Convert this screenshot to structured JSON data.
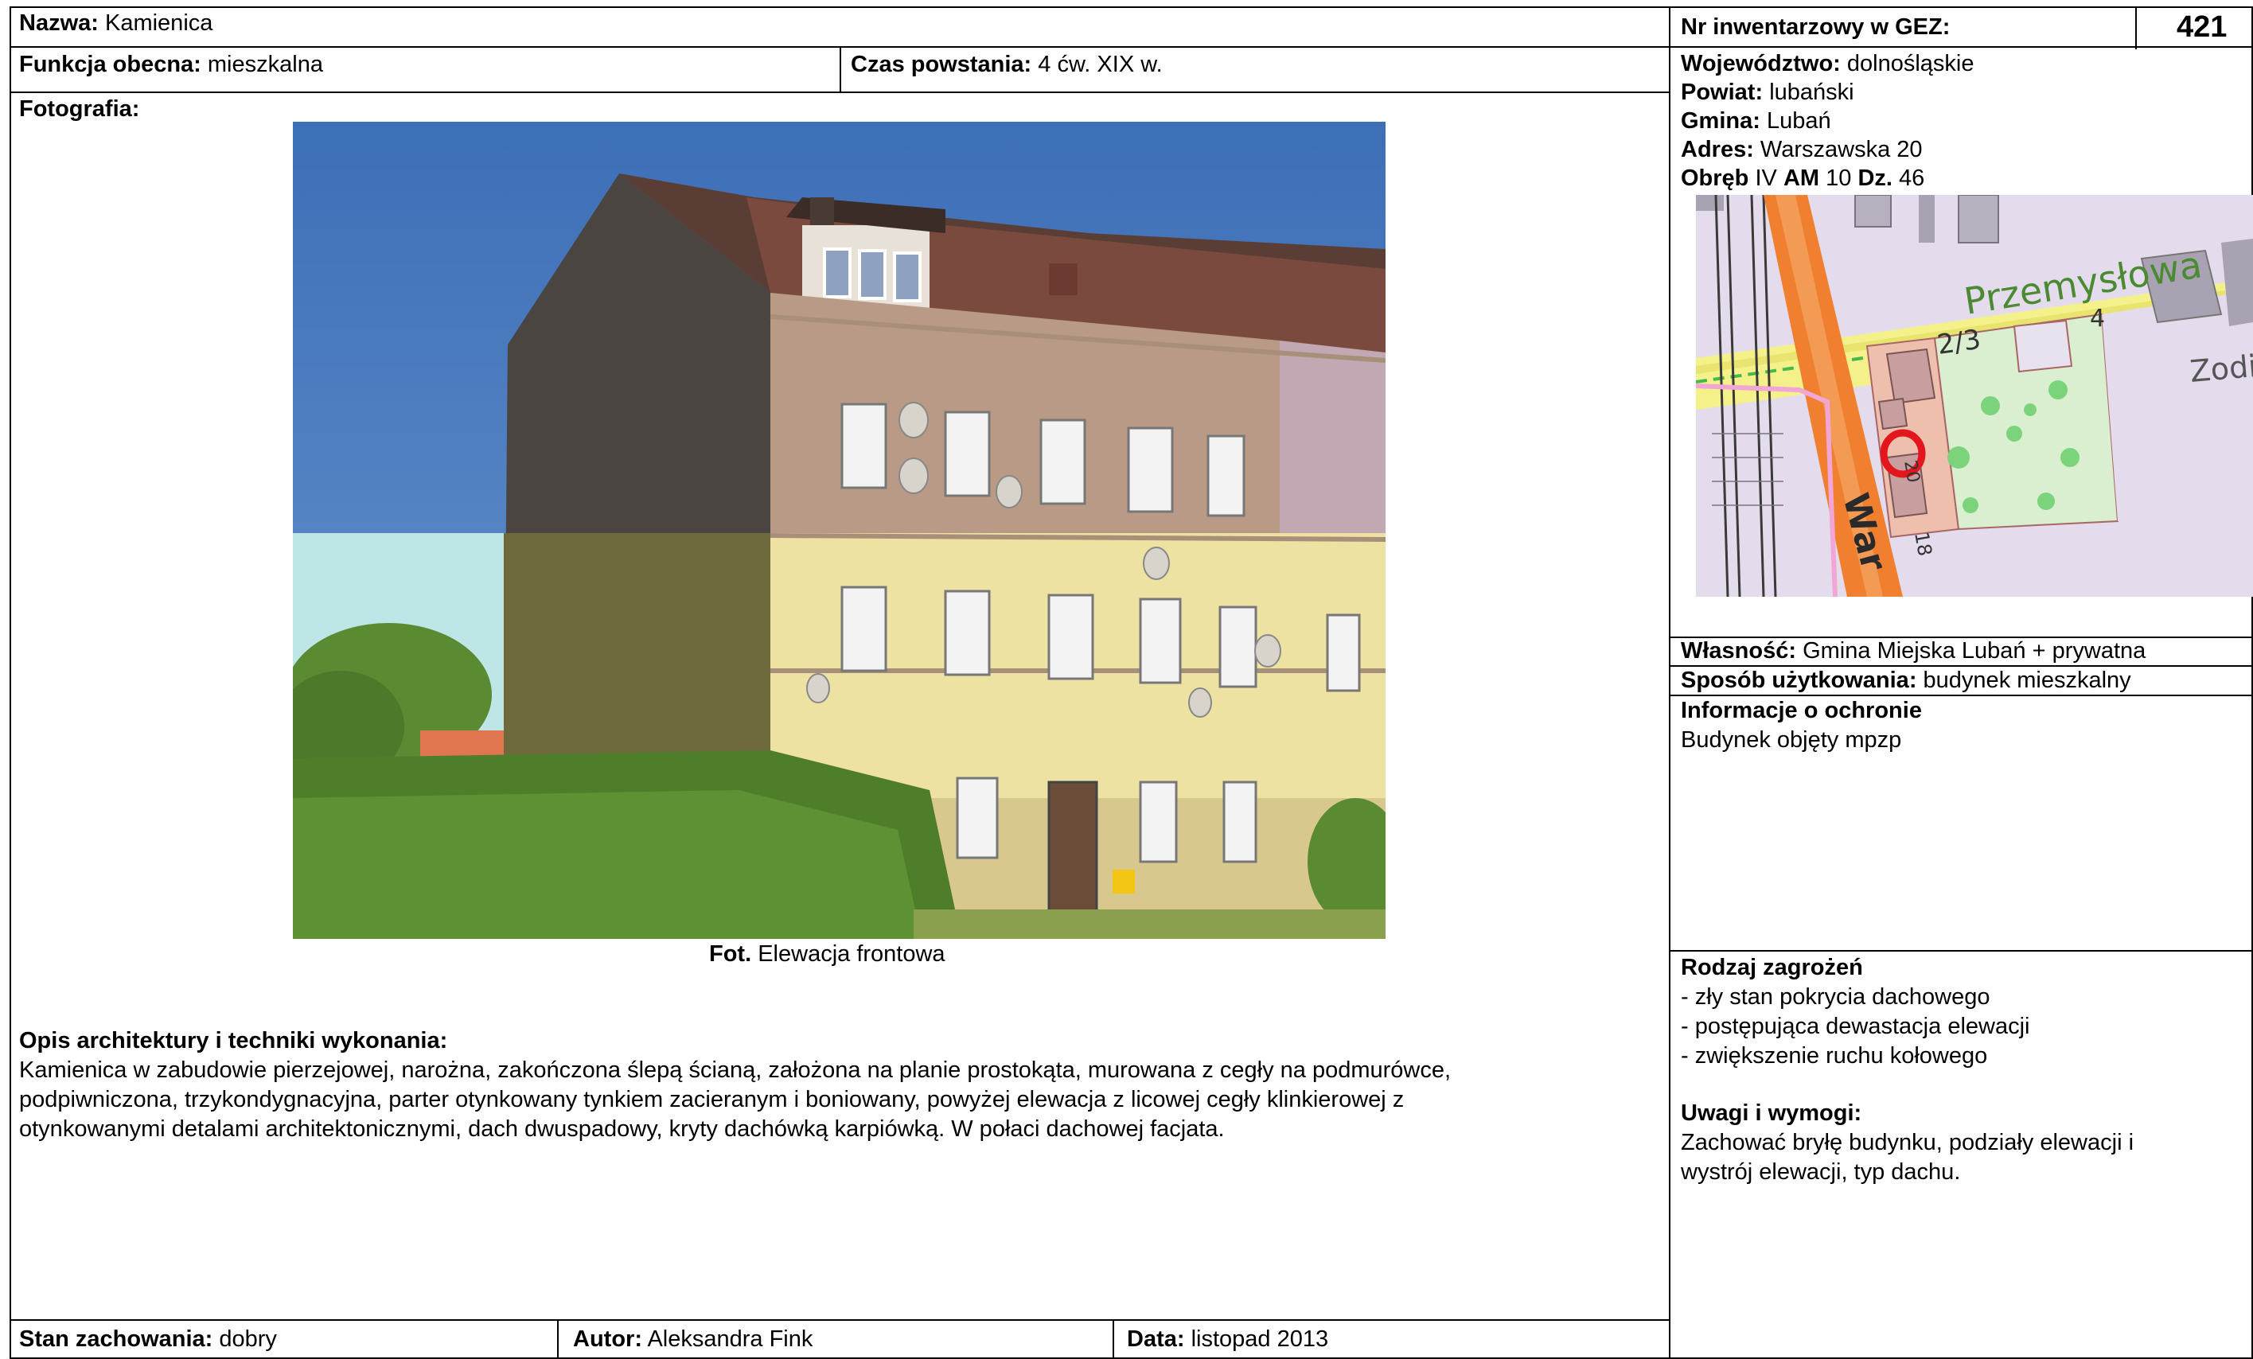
{
  "header": {
    "name_label": "Nazwa:",
    "name_value": "Kamienica",
    "inv_label": "Nr inwentarzowy w GEZ:",
    "inv_value": "421"
  },
  "info": {
    "function_label": "Funkcja obecna:",
    "function_value": "mieszkalna",
    "time_label": "Czas powstania:",
    "time_value": "4 ćw. XIX w."
  },
  "location": {
    "voiv_label": "Województwo:",
    "voiv_value": "dolnośląskie",
    "county_label": "Powiat:",
    "county_value": "lubański",
    "commune_label": "Gmina:",
    "commune_value": "Lubań",
    "address_label": "Adres:",
    "address_value": "Warszawska 20",
    "obreb_label": "Obręb",
    "obreb_value": "IV",
    "am_label": "AM",
    "am_value": "10",
    "dz_label": "Dz.",
    "dz_value": "46"
  },
  "map": {
    "street1": "Przemysłowa",
    "street2": "War",
    "label_23": "2/3",
    "label_4": "4",
    "label_zodi": "Zodi",
    "label_20": "20",
    "label_18": "18"
  },
  "photo": {
    "section_label": "Fotografia:",
    "caption_label": "Fot.",
    "caption_value": "Elewacja frontowa"
  },
  "description": {
    "label": "Opis architektury i techniki wykonania:",
    "lines": [
      "Kamienica w zabudowie pierzejowej, narożna, zakończona ślepą ścianą, założona na planie prostokąta, murowana z cegły na podmurówce,",
      "podpiwniczona, trzykondygnacyjna, parter otynkowany tynkiem zacieranym i boniowany, powyżej elewacja z licowej cegły klinkierowej z",
      "otynkowanymi detalami architektonicznymi, dach dwuspadowy, kryty dachówką karpiówką. W połaci dachowej facjata."
    ]
  },
  "ownership": {
    "owner_label": "Własność:",
    "owner_value": "Gmina Miejska Lubań + prywatna",
    "use_label": "Sposób użytkowania:",
    "use_value": "budynek mieszkalny"
  },
  "protection": {
    "label": "Informacje o ochronie",
    "value": "Budynek objęty mpzp"
  },
  "threats": {
    "label": "Rodzaj zagrożeń",
    "items": [
      "- zły stan pokrycia dachowego",
      "- postępująca dewastacja elewacji",
      "- zwiększenie ruchu kołowego"
    ]
  },
  "remarks": {
    "label": "Uwagi i wymogi:",
    "lines": [
      "Zachować bryłę budynku, podziały elewacji i",
      "wystrój elewacji, typ dachu."
    ]
  },
  "footer": {
    "condition_label": "Stan zachowania:",
    "condition_value": "dobry",
    "author_label": "Autor:",
    "author_value": "Aleksandra Fink",
    "date_label": "Data:",
    "date_value": "listopad 2013"
  }
}
